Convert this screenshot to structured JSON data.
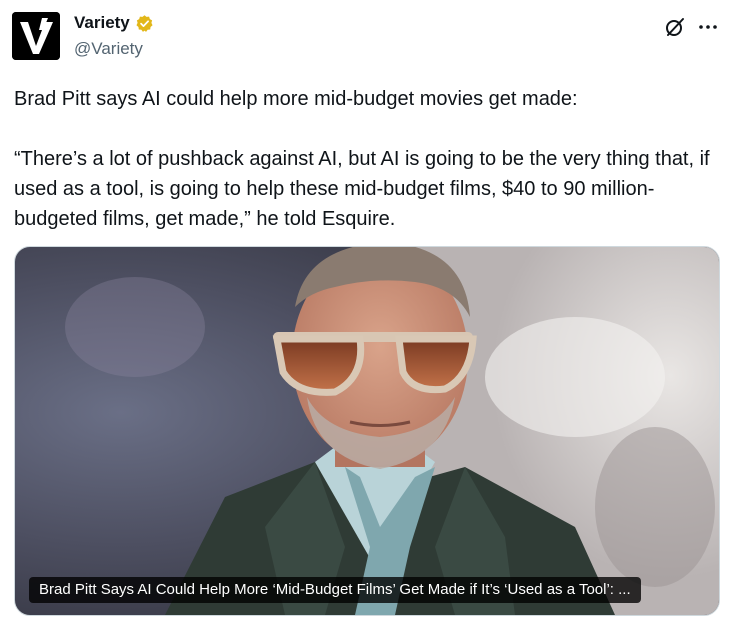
{
  "author": {
    "display_name": "Variety",
    "handle": "@Variety",
    "avatar_icon": "variety-v-logo",
    "verified_color": "#e2b719"
  },
  "actions": {
    "grok_icon": "grok-icon",
    "more_icon": "more-icon"
  },
  "tweet": {
    "line1": "Brad Pitt says AI could help more mid-budget movies get made:",
    "line2": "“There’s a lot of pushback against AI, but AI is going to be the very thing that, if used as a tool, is going to help these mid-budget films, $40 to 90 million-budgeted films, get made,” he told Esquire."
  },
  "media": {
    "caption": "Brad Pitt Says AI Could Help More ‘Mid-Budget Films’ Get Made if It’s ‘Used as a Tool’: ..."
  }
}
